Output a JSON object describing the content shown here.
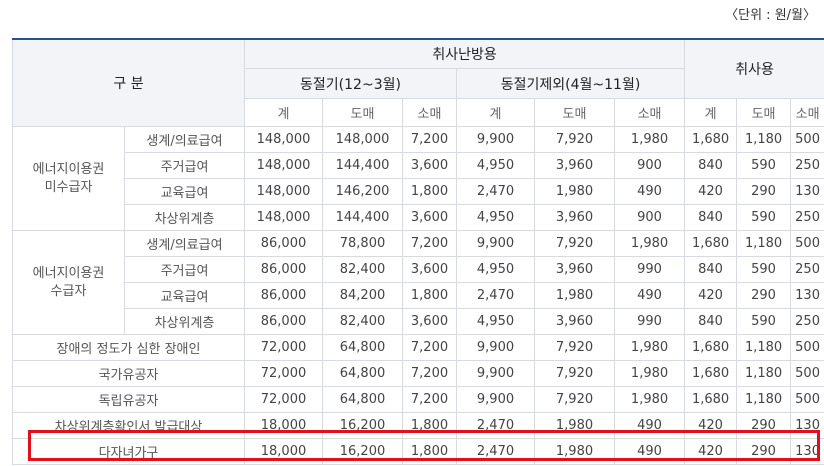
{
  "unit_label": "〈단위 : 원/월〉",
  "header": {
    "gubun": "구 분",
    "heating": "취사난방용",
    "winter": "동절기(12~3월)",
    "nonwinter": "동절기제외(4월~11월)",
    "cooking": "취사용",
    "cols": [
      "계",
      "도매",
      "소매",
      "계",
      "도매",
      "소매",
      "계",
      "도매",
      "소매"
    ]
  },
  "groups": [
    {
      "label_line1": "에너지이용권",
      "label_line2": "미수급자",
      "rows": [
        {
          "label": "생계/의료급여",
          "values": [
            "148,000",
            "148,000",
            "7,200",
            "9,900",
            "7,920",
            "1,980",
            "1,680",
            "1,180",
            "500"
          ]
        },
        {
          "label": "주거급여",
          "values": [
            "148,000",
            "144,400",
            "3,600",
            "4,950",
            "3,960",
            "900",
            "840",
            "590",
            "250"
          ]
        },
        {
          "label": "교육급여",
          "values": [
            "148,000",
            "146,200",
            "1,800",
            "2,470",
            "1,980",
            "490",
            "420",
            "290",
            "130"
          ]
        },
        {
          "label": "차상위계층",
          "values": [
            "148,000",
            "144,400",
            "3,600",
            "4,950",
            "3,960",
            "900",
            "840",
            "590",
            "250"
          ]
        }
      ]
    },
    {
      "label_line1": "에너지이용권",
      "label_line2": "수급자",
      "rows": [
        {
          "label": "생계/의료급여",
          "values": [
            "86,000",
            "78,800",
            "7,200",
            "9,900",
            "7,920",
            "1,980",
            "1,680",
            "1,180",
            "500"
          ]
        },
        {
          "label": "주거급여",
          "values": [
            "86,000",
            "82,400",
            "3,600",
            "4,950",
            "3,960",
            "990",
            "840",
            "590",
            "250"
          ]
        },
        {
          "label": "교육급여",
          "values": [
            "86,000",
            "84,200",
            "1,800",
            "2,470",
            "1,980",
            "490",
            "420",
            "290",
            "130"
          ]
        },
        {
          "label": "차상위계층",
          "values": [
            "86,000",
            "82,400",
            "3,600",
            "4,950",
            "3,960",
            "990",
            "840",
            "590",
            "250"
          ]
        }
      ]
    }
  ],
  "single_rows": [
    {
      "label": "장애의 정도가 심한 장애인",
      "values": [
        "72,000",
        "64,800",
        "7,200",
        "9,900",
        "7,920",
        "1,980",
        "1,680",
        "1,180",
        "500"
      ]
    },
    {
      "label": "국가유공자",
      "values": [
        "72,000",
        "64,800",
        "7,200",
        "9,900",
        "7,920",
        "1,980",
        "1,680",
        "1,180",
        "500"
      ]
    },
    {
      "label": "독립유공자",
      "values": [
        "72,000",
        "64,800",
        "7,200",
        "9,900",
        "7,920",
        "1,980",
        "1,680",
        "1,180",
        "500"
      ]
    },
    {
      "label": "차상위계층확인서 발급대상",
      "values": [
        "18,000",
        "16,200",
        "1,800",
        "2,470",
        "1,980",
        "490",
        "420",
        "290",
        "130"
      ]
    },
    {
      "label": "다자녀가구",
      "values": [
        "18,000",
        "16,200",
        "1,800",
        "2,470",
        "1,980",
        "490",
        "420",
        "290",
        "130"
      ]
    }
  ],
  "highlight_color": "#e0101d",
  "header_border_color": "#2e4f8f"
}
